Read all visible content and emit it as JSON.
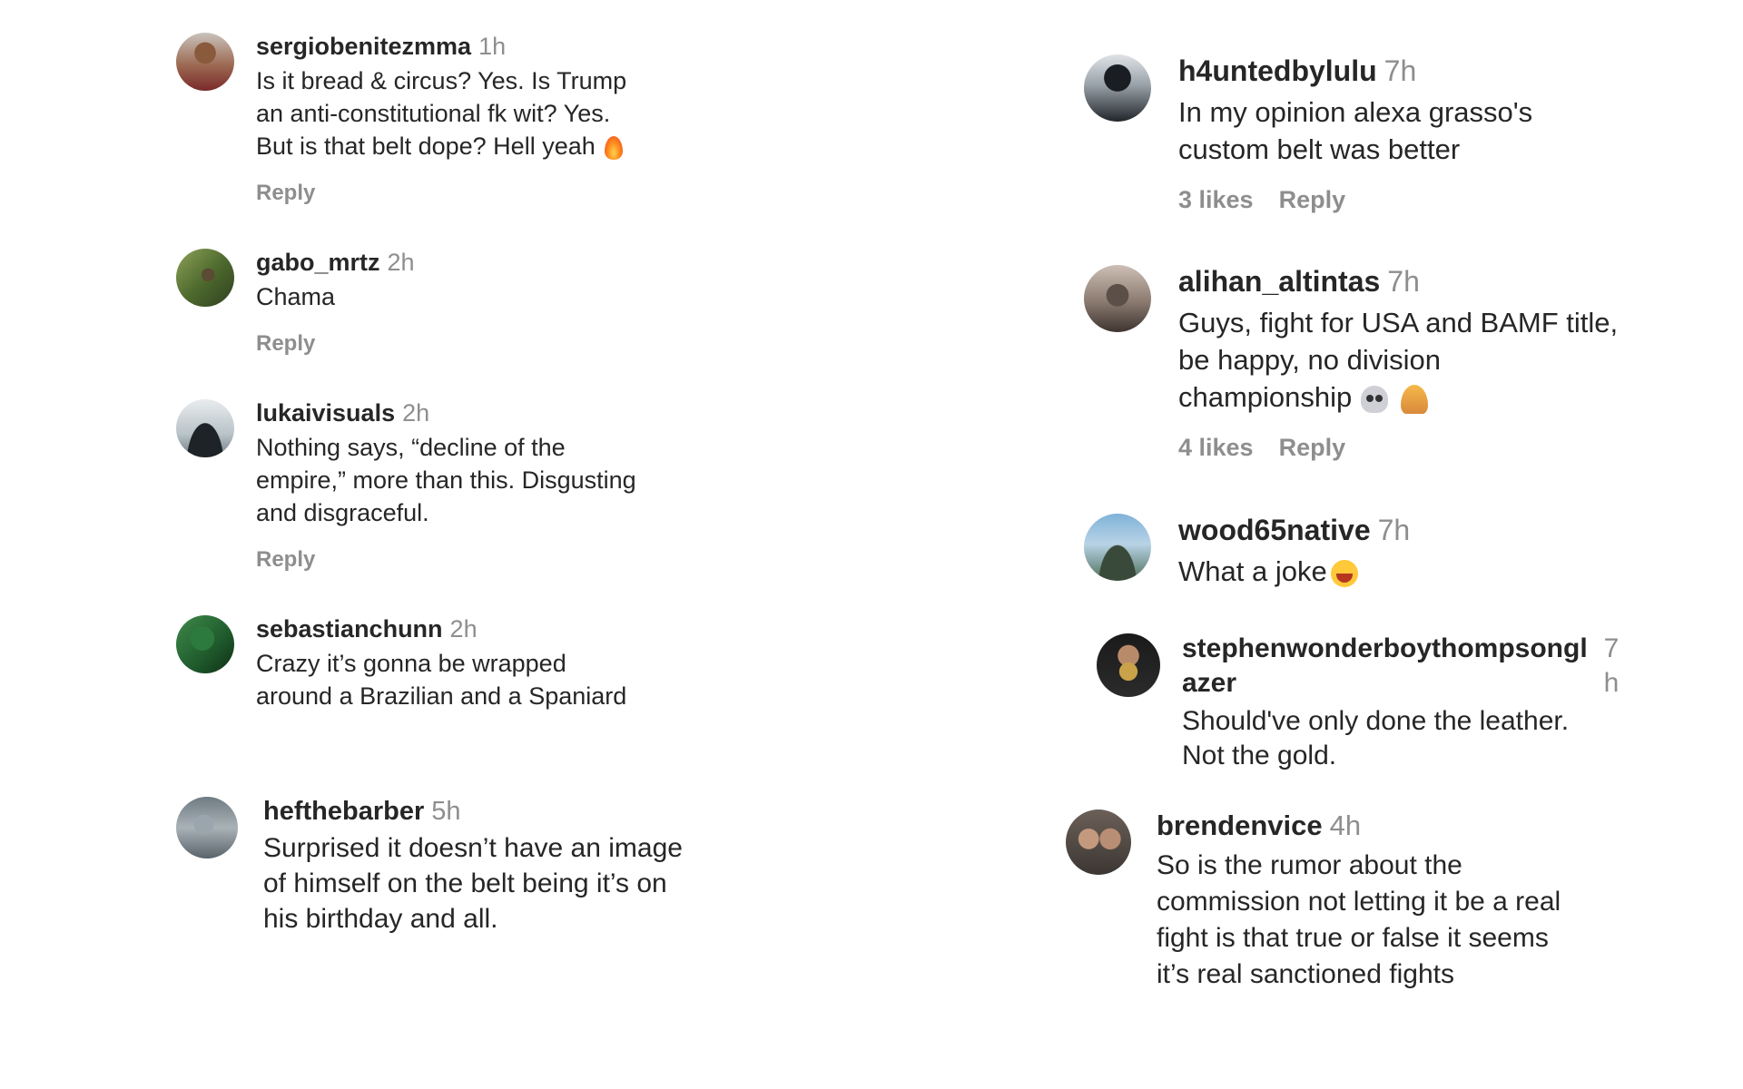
{
  "left_comments": [
    {
      "username": "sergiobenitezmma",
      "time": "1h",
      "lines": [
        "Is it bread & circus? Yes. Is Trump",
        "an anti-constitutional fk wit? Yes.",
        "But is that belt dope? Hell yeah"
      ],
      "emoji": "fire-emoji",
      "reply": "Reply"
    },
    {
      "username": "gabo_mrtz",
      "time": "2h",
      "lines": [
        "Chama"
      ],
      "reply": "Reply"
    },
    {
      "username": "lukaivisuals",
      "time": "2h",
      "lines": [
        "Nothing says, “decline of the",
        "empire,” more than this. Disgusting",
        "and disgraceful."
      ],
      "reply": "Reply"
    },
    {
      "username": "sebastianchunn",
      "time": "2h",
      "lines": [
        "Crazy it’s gonna be wrapped",
        "around a Brazilian and a Spaniard"
      ]
    },
    {
      "username": "hefthebarber",
      "time": "5h",
      "lines": [
        "Surprised it doesn’t have an image",
        "of himself on the belt being it’s on",
        "his birthday and all."
      ]
    }
  ],
  "right_comments": [
    {
      "username": "h4untedbylulu",
      "time": "7h",
      "lines": [
        "In my opinion alexa grasso's",
        "custom belt was better"
      ],
      "likes": "3 likes",
      "reply": "Reply"
    },
    {
      "username": "alihan_altintas",
      "time": "7h",
      "lines": [
        "Guys, fight for USA and BAMF title,",
        "be happy, no division",
        "championship"
      ],
      "emojis": [
        "skull-emoji",
        "folded-hands-emoji"
      ],
      "likes": "4 likes",
      "reply": "Reply"
    },
    {
      "username": "wood65native",
      "time": "7h",
      "lines": [
        "What a joke"
      ],
      "emoji": "laughing-emoji"
    },
    {
      "username_line1": "stephenwonderboythompsongl",
      "username_line2": "azer",
      "time_line1": "7",
      "time_line2": "h",
      "lines": [
        "Should've only done the leather.",
        "Not the gold."
      ]
    },
    {
      "username": "brendenvice",
      "time": "4h",
      "lines": [
        "So is the rumor about the",
        "commission not letting it be a real",
        "fight is that true or false it seems",
        "it’s real sanctioned fights"
      ]
    }
  ],
  "colors": {
    "username": "#262626",
    "text": "#262626",
    "meta": "#8e8e8e",
    "background": "#ffffff"
  }
}
